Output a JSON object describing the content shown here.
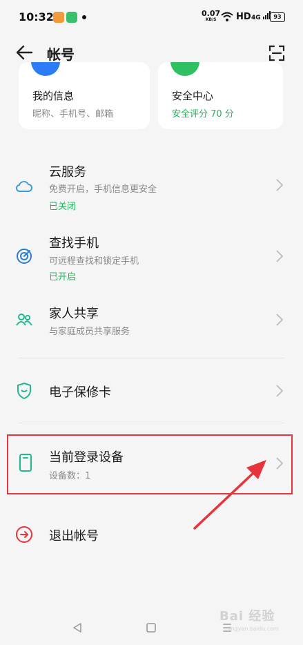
{
  "status_bar": {
    "time": "10:32",
    "net_speed": "0.07",
    "net_unit": "KB/S",
    "hd": "HD",
    "signal": "4G",
    "battery": "93"
  },
  "header": {
    "title": "帐号"
  },
  "cards": [
    {
      "title": "我的信息",
      "subtitle": "昵称、手机号、邮箱",
      "color": "#2b7cf6"
    },
    {
      "title": "安全中心",
      "subtitle": "安全评分 70 分",
      "color": "#2fc062"
    }
  ],
  "settings": [
    {
      "title": "云服务",
      "desc": "免费开启，手机信息更安全",
      "status": "已关闭",
      "icon": "cloud-icon"
    },
    {
      "title": "查找手机",
      "desc": "可远程查找和锁定手机",
      "status": "已开启",
      "icon": "target-icon"
    },
    {
      "title": "家人共享",
      "desc": "与家庭成员共享服务",
      "icon": "family-icon"
    },
    {
      "title": "电子保修卡",
      "icon": "shield-icon"
    },
    {
      "title": "当前登录设备",
      "desc": "设备数：1",
      "icon": "device-icon"
    },
    {
      "title": "退出帐号",
      "icon": "logout-icon"
    }
  ],
  "watermark": {
    "text": "Bai 经验",
    "sub": "jingyan.baidu.com"
  },
  "colors": {
    "accent_green": "#1fb25a",
    "highlight_red": "#e8333a",
    "icon_teal": "#1fb893"
  }
}
